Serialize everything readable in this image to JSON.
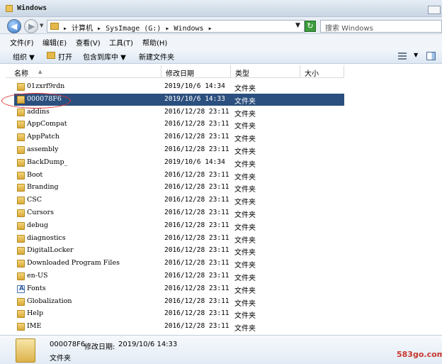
{
  "window": {
    "title": "Windows"
  },
  "address": {
    "breadcrumb": "▸ 计算机 ▸ SysImage (G:) ▸ Windows ▸",
    "search_placeholder": "搜索 Windows"
  },
  "menu": [
    "文件(F)",
    "编辑(E)",
    "查看(V)",
    "工具(T)",
    "帮助(H)"
  ],
  "toolbar": {
    "organize": "组织 ▼",
    "open": "打开",
    "include_in_library": "包含到库中 ▼",
    "new_folder": "新建文件夹"
  },
  "columns": {
    "name": "名称",
    "date": "修改日期",
    "type": "类型",
    "size": "大小"
  },
  "files": [
    {
      "name": "01zxrf9rdn",
      "date": "2019/10/6 14:34",
      "type": "文件夹"
    },
    {
      "name": "000078F6",
      "date": "2019/10/6 14:33",
      "type": "文件夹",
      "selected": true
    },
    {
      "name": "addins",
      "date": "2016/12/28 23:11",
      "type": "文件夹"
    },
    {
      "name": "AppCompat",
      "date": "2016/12/28 23:11",
      "type": "文件夹"
    },
    {
      "name": "AppPatch",
      "date": "2016/12/28 23:11",
      "type": "文件夹"
    },
    {
      "name": "assembly",
      "date": "2016/12/28 23:11",
      "type": "文件夹"
    },
    {
      "name": "BackDump_",
      "date": "2019/10/6 14:34",
      "type": "文件夹"
    },
    {
      "name": "Boot",
      "date": "2016/12/28 23:11",
      "type": "文件夹"
    },
    {
      "name": "Branding",
      "date": "2016/12/28 23:11",
      "type": "文件夹"
    },
    {
      "name": "CSC",
      "date": "2016/12/28 23:11",
      "type": "文件夹"
    },
    {
      "name": "Cursors",
      "date": "2016/12/28 23:11",
      "type": "文件夹"
    },
    {
      "name": "debug",
      "date": "2016/12/28 23:11",
      "type": "文件夹"
    },
    {
      "name": "diagnostics",
      "date": "2016/12/28 23:11",
      "type": "文件夹"
    },
    {
      "name": "DigitalLocker",
      "date": "2016/12/28 23:11",
      "type": "文件夹"
    },
    {
      "name": "Downloaded Program Files",
      "date": "2016/12/28 23:11",
      "type": "文件夹"
    },
    {
      "name": "en-US",
      "date": "2016/12/28 23:11",
      "type": "文件夹"
    },
    {
      "name": "Fonts",
      "date": "2016/12/28 23:11",
      "type": "文件夹",
      "icon": "fonts-folder-icon"
    },
    {
      "name": "Globalization",
      "date": "2016/12/28 23:11",
      "type": "文件夹"
    },
    {
      "name": "Help",
      "date": "2016/12/28 23:11",
      "type": "文件夹"
    },
    {
      "name": "IME",
      "date": "2016/12/28 23:11",
      "type": "文件夹"
    }
  ],
  "status": {
    "name": "000078F6",
    "date_label": "修改日期:",
    "date": "2019/10/6 14:33",
    "type": "文件夹"
  },
  "watermark": "583go.com",
  "colors": {
    "selection": "#2b4f7e",
    "highlight_ellipse": "#dd3333"
  }
}
